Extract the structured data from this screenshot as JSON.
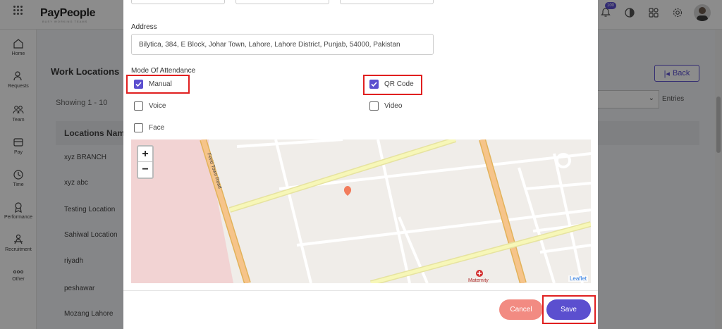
{
  "app": {
    "logo": "PayPeople",
    "logo_tagline": "BUSY WORKING TEAMS",
    "notification_count": "100"
  },
  "sidebar": {
    "items": [
      {
        "label": "Home",
        "icon": "home-icon"
      },
      {
        "label": "Requests",
        "icon": "requests-icon"
      },
      {
        "label": "Team",
        "icon": "team-icon"
      },
      {
        "label": "Pay",
        "icon": "pay-icon"
      },
      {
        "label": "Time",
        "icon": "clock-icon"
      },
      {
        "label": "Performance",
        "icon": "performance-icon"
      },
      {
        "label": "Recruitment",
        "icon": "recruitment-icon"
      },
      {
        "label": "Other",
        "icon": "more-icon"
      }
    ]
  },
  "page": {
    "title": "Work Locations",
    "back_label": "Back",
    "showing": "Showing 1 - 10",
    "entries_label": "Entries",
    "table_header": "Locations Name",
    "rows": [
      "xyz BRANCH",
      "xyz abc",
      "Testing Location",
      "Sahiwal Location",
      "riyadh",
      "peshawar",
      "Mozang Lahore"
    ]
  },
  "modal": {
    "address_label": "Address",
    "address_value": "Bilytica, 384, E Block, Johar Town, Lahore, Lahore District, Punjab, 54000, Pakistan",
    "mode_label": "Mode Of Attendance",
    "options": [
      {
        "label": "Manual",
        "checked": true
      },
      {
        "label": "QR Code",
        "checked": true
      },
      {
        "label": "Voice",
        "checked": false
      },
      {
        "label": "Video",
        "checked": false
      },
      {
        "label": "Face",
        "checked": false
      }
    ],
    "map": {
      "road_label": "Ferid Town Road",
      "poi_label": "Maternity",
      "attribution": "Leaflet",
      "zoom_in": "+",
      "zoom_out": "−"
    },
    "cancel_label": "Cancel",
    "save_label": "Save"
  },
  "colors": {
    "accent": "#5b4fcf",
    "cancel": "#f28b82",
    "highlight": "#e02020"
  }
}
